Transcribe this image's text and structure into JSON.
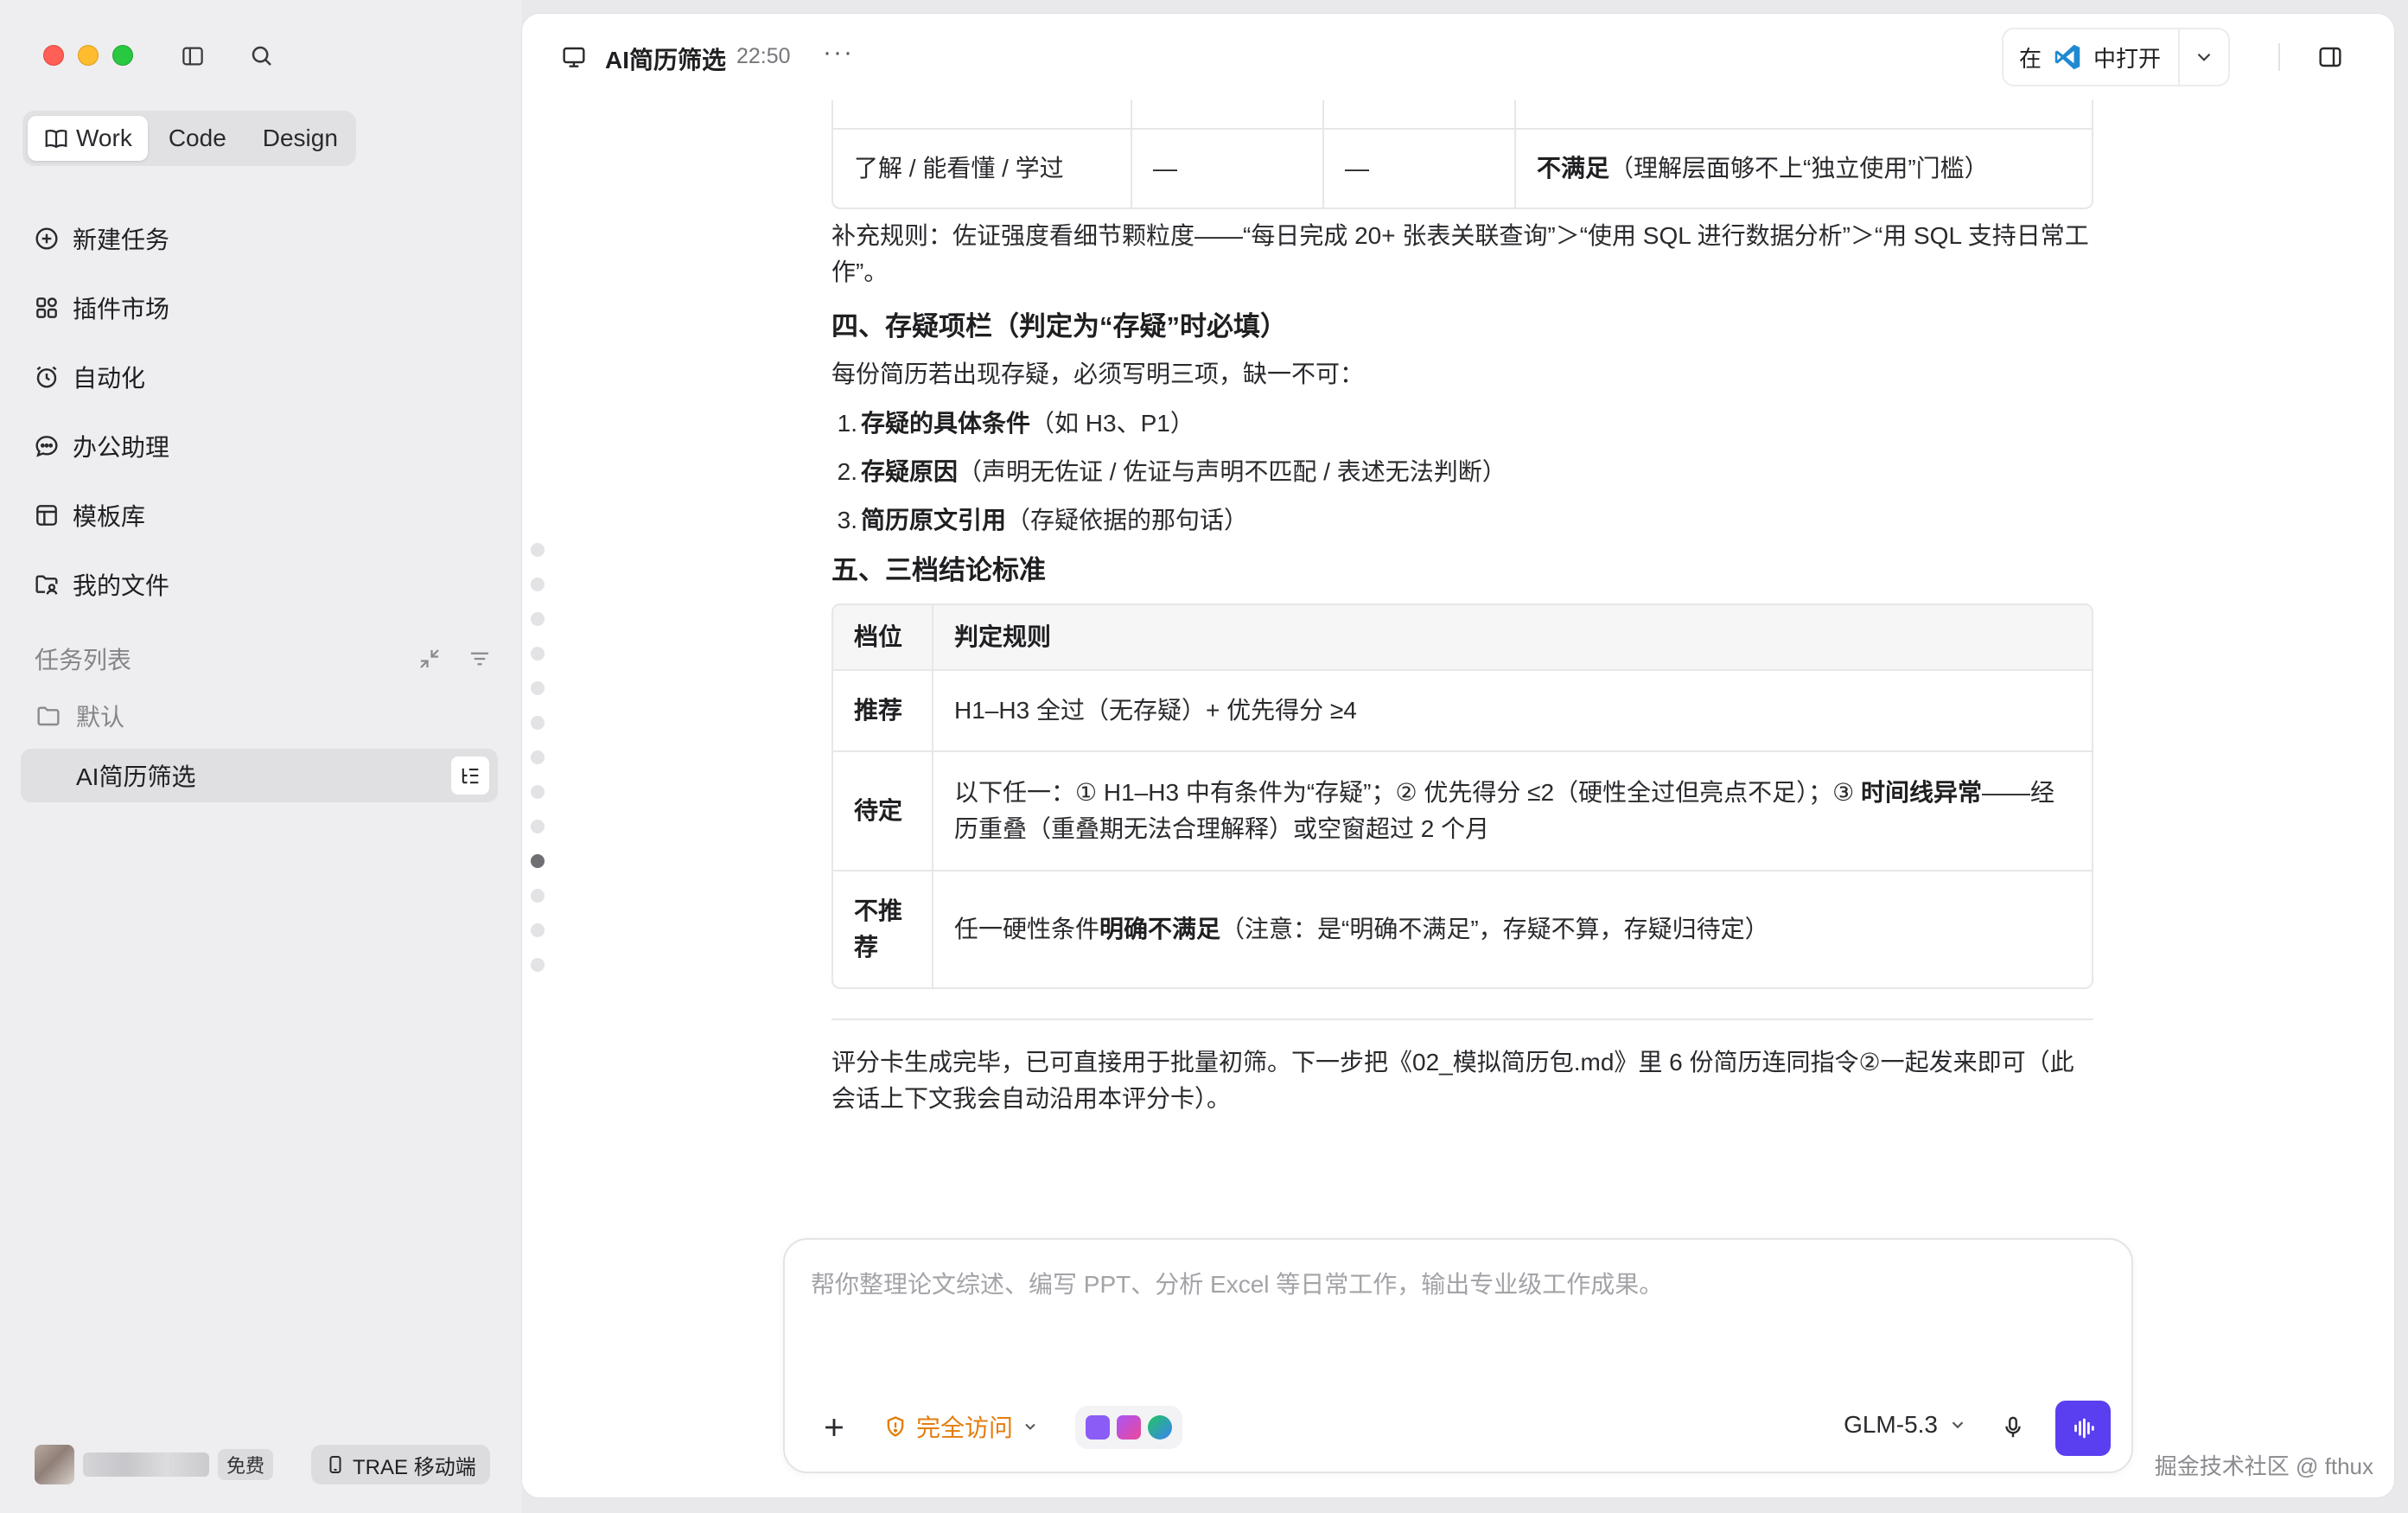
{
  "sidebar": {
    "modes": [
      {
        "label": "Work",
        "icon": "book-icon",
        "active": true
      },
      {
        "label": "Code",
        "active": false
      },
      {
        "label": "Design",
        "active": false
      }
    ],
    "nav": [
      {
        "label": "新建任务",
        "icon": "plus-circle-icon"
      },
      {
        "label": "插件市场",
        "icon": "plugin-icon"
      },
      {
        "label": "自动化",
        "icon": "alarm-clock-icon"
      },
      {
        "label": "办公助理",
        "icon": "chat-bubble-icon"
      },
      {
        "label": "模板库",
        "icon": "template-icon"
      },
      {
        "label": "我的文件",
        "icon": "folder-user-icon"
      }
    ],
    "tasks_header": "任务列表",
    "folder": "默认",
    "active_task": "AI简历筛选",
    "free_badge": "免费",
    "mobile_label": "TRAE 移动端"
  },
  "header": {
    "title": "AI简历筛选",
    "time": "22:50",
    "more": "···",
    "open_prefix": "在",
    "open_suffix": "中打开"
  },
  "content": {
    "table_top": {
      "row": [
        "了解 / 能看懂 / 学过",
        "—",
        "—"
      ],
      "result_bold": "不满足",
      "result_rest": "（理解层面够不上“独立使用”门槛）"
    },
    "supplement": "补充规则：佐证强度看细节颗粒度——“每日完成 20+ 张表关联查询”＞“使用 SQL 进行数据分析”＞“用 SQL 支持日常工作”。",
    "section4_title": "四、存疑项栏（判定为“存疑”时必填）",
    "section4_intro": "每份简历若出现存疑，必须写明三项，缺一不可：",
    "section4_items": [
      {
        "num": "1.",
        "bold": "存疑的具体条件",
        "rest": "（如 H3、P1）"
      },
      {
        "num": "2.",
        "bold": "存疑原因",
        "rest": "（声明无佐证 / 佐证与声明不匹配 / 表述无法判断）"
      },
      {
        "num": "3.",
        "bold": "简历原文引用",
        "rest": "（存疑依据的那句话）"
      }
    ],
    "section5_title": "五、三档结论标准",
    "verdict_table": {
      "headers": [
        "档位",
        "判定规则"
      ],
      "rows": [
        {
          "level": "推荐",
          "rule": "H1–H3 全过（无存疑）+ 优先得分 ≥4"
        },
        {
          "level": "待定",
          "rule_a": "以下任一：① H1–H3 中有条件为“存疑”；② 优先得分 ≤2（硬性全过但亮点不足）；③ ",
          "rule_bold": "时间线异常",
          "rule_b": "——经历重叠（重叠期无法合理解释）或空窗超过 2 个月"
        },
        {
          "level": "不推荐",
          "rule_a": "任一硬性条件",
          "rule_bold": "明确不满足",
          "rule_b": "（注意：是“明确不满足”，存疑不算，存疑归待定）"
        }
      ]
    },
    "closing": "评分卡生成完毕，已可直接用于批量初筛。下一步把《02_模拟简历包.md》里 6 份简历连同指令②一起发来即可（此会话上下文我会自动沿用本评分卡）。"
  },
  "composer": {
    "placeholder": "帮你整理论文综述、编写 PPT、分析 Excel 等日常工作，输出专业级工作成果。",
    "access_label": "完全访问",
    "model": "GLM-5.3"
  },
  "watermark": "掘金技术社区 @ fthux",
  "colors": {
    "accent": "#5a3ff0",
    "access": "#e47d0d",
    "sidebar_bg": "#eeeef0"
  }
}
